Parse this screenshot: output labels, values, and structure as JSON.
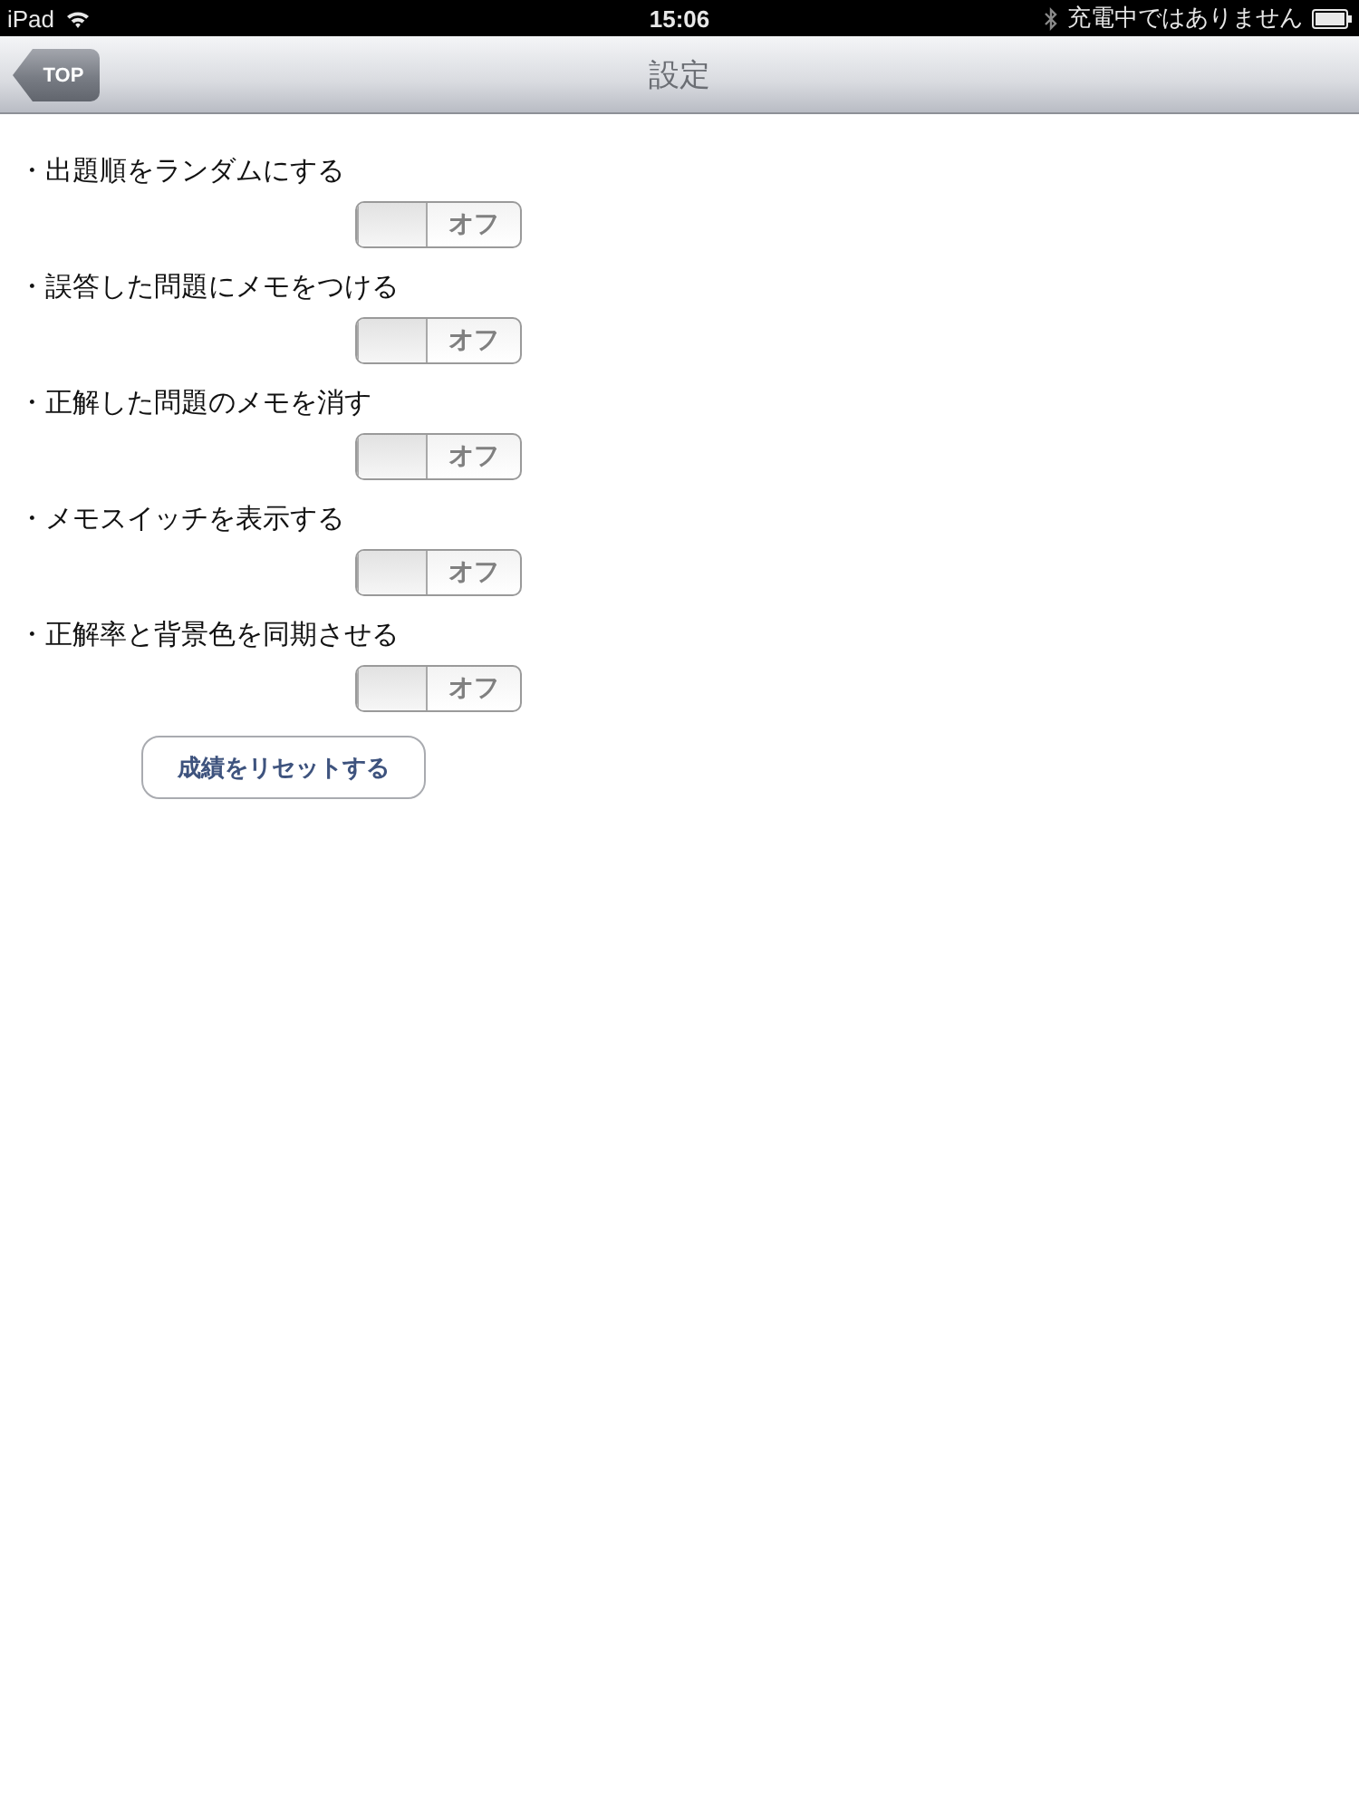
{
  "status_bar": {
    "device": "iPad",
    "time": "15:06",
    "battery_status": "充電中ではありません"
  },
  "nav_bar": {
    "back_button": "TOP",
    "title": "設定"
  },
  "settings": [
    {
      "label": "・出題順をランダムにする",
      "on": false,
      "switch_text": "オフ"
    },
    {
      "label": "・誤答した問題にメモをつける",
      "on": false,
      "switch_text": "オフ"
    },
    {
      "label": "・正解した問題のメモを消す",
      "on": false,
      "switch_text": "オフ"
    },
    {
      "label": "・メモスイッチを表示する",
      "on": false,
      "switch_text": "オフ"
    },
    {
      "label": "・正解率と背景色を同期させる",
      "on": false,
      "switch_text": "オフ"
    }
  ],
  "reset_button": "成績をリセットする"
}
